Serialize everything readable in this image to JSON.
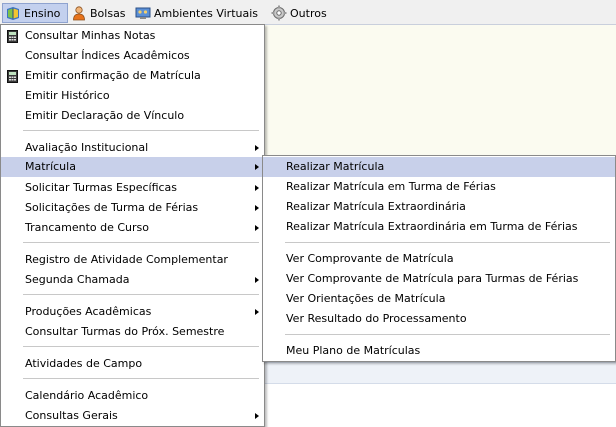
{
  "menubar": {
    "items": [
      {
        "label": "Ensino",
        "icon": "book-icon"
      },
      {
        "label": "Bolsas",
        "icon": "person-icon"
      },
      {
        "label": "Ambientes Virtuais",
        "icon": "people-screen-icon"
      },
      {
        "label": "Outros",
        "icon": "gear-icon"
      }
    ]
  },
  "ensino_menu": {
    "items": [
      "Consultar Minhas Notas",
      "Consultar Índices Acadêmicos",
      "Emitir confirmação de Matrícula",
      "Emitir Histórico",
      "Emitir Declaração de Vínculo",
      "Avaliação Institucional",
      "Matrícula",
      "Solicitar Turmas Específicas",
      "Solicitações de Turma de Férias",
      "Trancamento de Curso",
      "Registro de Atividade Complementar",
      "Segunda Chamada",
      "Produções Acadêmicas",
      "Consultar Turmas do Próx. Semestre",
      "Atividades de Campo",
      "Calendário Acadêmico",
      "Consultas Gerais"
    ]
  },
  "matricula_submenu": {
    "items": [
      "Realizar Matrícula",
      "Realizar Matrícula em Turma de Férias",
      "Realizar Matrícula Extraordinária",
      "Realizar Matrícula Extraordinária em Turma de Férias",
      "Ver Comprovante de Matrícula",
      "Ver Comprovante de Matrícula para Turmas de Férias",
      "Ver Orientações de Matrícula",
      "Ver Resultado do Processamento",
      "Meu Plano de Matrículas"
    ]
  },
  "colors": {
    "highlight": "#c8d0ea",
    "menubar_active": "#c3d0ee"
  }
}
